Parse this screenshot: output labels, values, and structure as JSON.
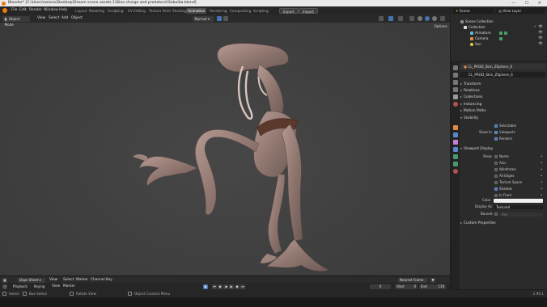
{
  "window": {
    "title": "Blender* [C:\\Users\\asiono\\Desktop\\Dream scene assets 1\\Dino charge and predatorsl\\Sebulba.blend]",
    "controls": "—  ☐  ✕"
  },
  "menubar": {
    "menus": [
      "File",
      "Edit",
      "Render",
      "Window",
      "Help"
    ],
    "workspaces": [
      "Layout",
      "Modeling",
      "Sculpting",
      "UV Editing",
      "Texture Paint",
      "Shading",
      "Animation",
      "Rendering",
      "Compositing",
      "Scripting"
    ],
    "active_workspace": "Animation",
    "export_label": "Export",
    "import_label": "Import",
    "scene_label": "Scene",
    "view_layer_label": "View Layer"
  },
  "viewport_header": {
    "mode": "Object Mode",
    "menus": [
      "View",
      "Select",
      "Add",
      "Object"
    ],
    "orientation": "Normal",
    "options_label": "Options"
  },
  "outliner": {
    "rows": [
      {
        "label": "Scene Collection",
        "icon_color": "#8a8a8a",
        "indent": 0
      },
      {
        "label": "Collection",
        "icon_color": "#d9d9d9",
        "indent": 1
      },
      {
        "label": "Armature",
        "icon_color": "#5fb4d9",
        "indent": 2
      },
      {
        "label": "Camera",
        "icon_color": "#e08a46",
        "indent": 2
      },
      {
        "label": "Sun",
        "icon_color": "#e0c646",
        "indent": 2
      }
    ]
  },
  "properties": {
    "object_name": "CL_PROD_Skin_ZSphere_6",
    "object_field": "CL_PROD_Skin_ZSphere_6",
    "sections": [
      "Transform",
      "Relations",
      "Collections",
      "Instancing",
      "Motion Paths",
      "Visibility"
    ],
    "visibility": {
      "selectable_label": "Selectable",
      "show_in_label": "Show In",
      "viewports_label": "Viewports",
      "renders_label": "Renders"
    },
    "viewport_display": {
      "header": "Viewport Display",
      "show_label": "Show",
      "options": [
        {
          "label": "Name",
          "checked": false
        },
        {
          "label": "Axis",
          "checked": false
        },
        {
          "label": "Wireframe",
          "checked": false
        },
        {
          "label": "All Edges",
          "checked": false
        },
        {
          "label": "Texture Space",
          "checked": false
        },
        {
          "label": "Shadow",
          "checked": true
        },
        {
          "label": "In Front",
          "checked": false
        }
      ],
      "color_label": "Color",
      "display_as_label": "Display As",
      "display_as_value": "Textured",
      "bounds_label": "Bounds",
      "bounds_value": "Box"
    },
    "custom_properties": "Custom Properties"
  },
  "dopesheet": {
    "editor": "Dope Sheet",
    "menus": [
      "View",
      "Select",
      "Marker",
      "Channel",
      "Key"
    ],
    "snap": "Nearest Frame"
  },
  "timeline": {
    "playback": "Playback",
    "keying": "Keying",
    "menus": [
      "View",
      "Marker"
    ],
    "current_frame": "0",
    "start_label": "Start",
    "start_value": "0",
    "end_label": "End",
    "end_value": "116"
  },
  "statusbar": {
    "select": "Select",
    "box_select": "Box Select",
    "rotate_view": "Rotate View",
    "context_menu": "Object Context Menu",
    "version": "2.90.1"
  }
}
